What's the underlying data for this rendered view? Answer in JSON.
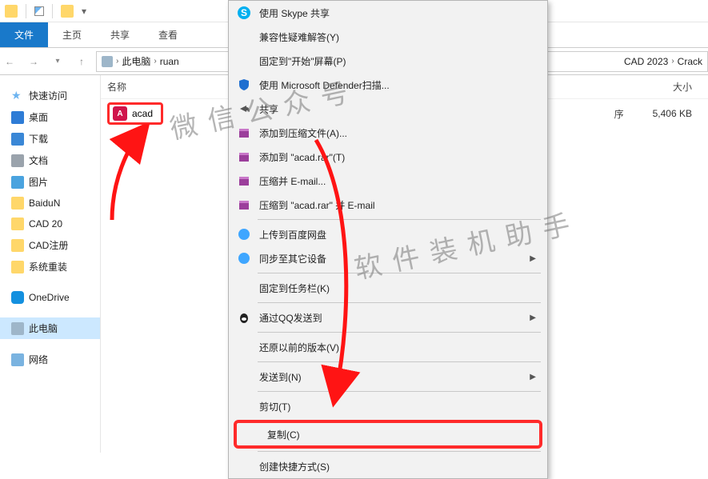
{
  "titlebar": {
    "check_on": true
  },
  "ribbon": {
    "tabs": [
      {
        "label": "文件",
        "active": true
      },
      {
        "label": "主页"
      },
      {
        "label": "共享"
      },
      {
        "label": "查看"
      }
    ]
  },
  "breadcrumb": {
    "segments": [
      "此电脑",
      "ruan",
      "CAD 2023",
      "Crack"
    ],
    "seg0": "此电脑",
    "seg1": "ruan",
    "seg_right1": "CAD 2023",
    "seg_right2": "Crack"
  },
  "columns": {
    "name": "名称",
    "size": "大小"
  },
  "sidebar": {
    "quick": "快速访问",
    "items": {
      "desktop": "桌面",
      "downloads": "下载",
      "documents": "文档",
      "pictures": "图片",
      "baidu": "BaiduN",
      "cad20": "CAD 20",
      "cadreg": "CAD注册",
      "sysrest": "系统重装"
    },
    "onedrive": "OneDrive",
    "thispc": "此电脑",
    "network": "网络"
  },
  "file": {
    "name": "acad",
    "type": "序",
    "size": "5,406 KB"
  },
  "ctx": {
    "skype": "使用 Skype 共享",
    "compat": "兼容性疑难解答(Y)",
    "pin_start": "固定到\"开始\"屏幕(P)",
    "defender": "使用 Microsoft Defender扫描...",
    "share": "共享",
    "add_archive": "添加到压缩文件(A)...",
    "add_rar": "添加到 \"acad.rar\"(T)",
    "compress_email": "压缩并 E-mail...",
    "compress_rar_email": "压缩到 \"acad.rar\" 并 E-mail",
    "baidu_upload": "上传到百度网盘",
    "baidu_sync": "同步至其它设备",
    "pin_taskbar": "固定到任务栏(K)",
    "qq_send": "通过QQ发送到",
    "restore": "还原以前的版本(V)",
    "sendto": "发送到(N)",
    "cut": "剪切(T)",
    "copy": "复制(C)",
    "shortcut": "创建快捷方式(S)"
  },
  "watermarks": {
    "w1": "微信公众号",
    "w2": "软件装机助手"
  }
}
